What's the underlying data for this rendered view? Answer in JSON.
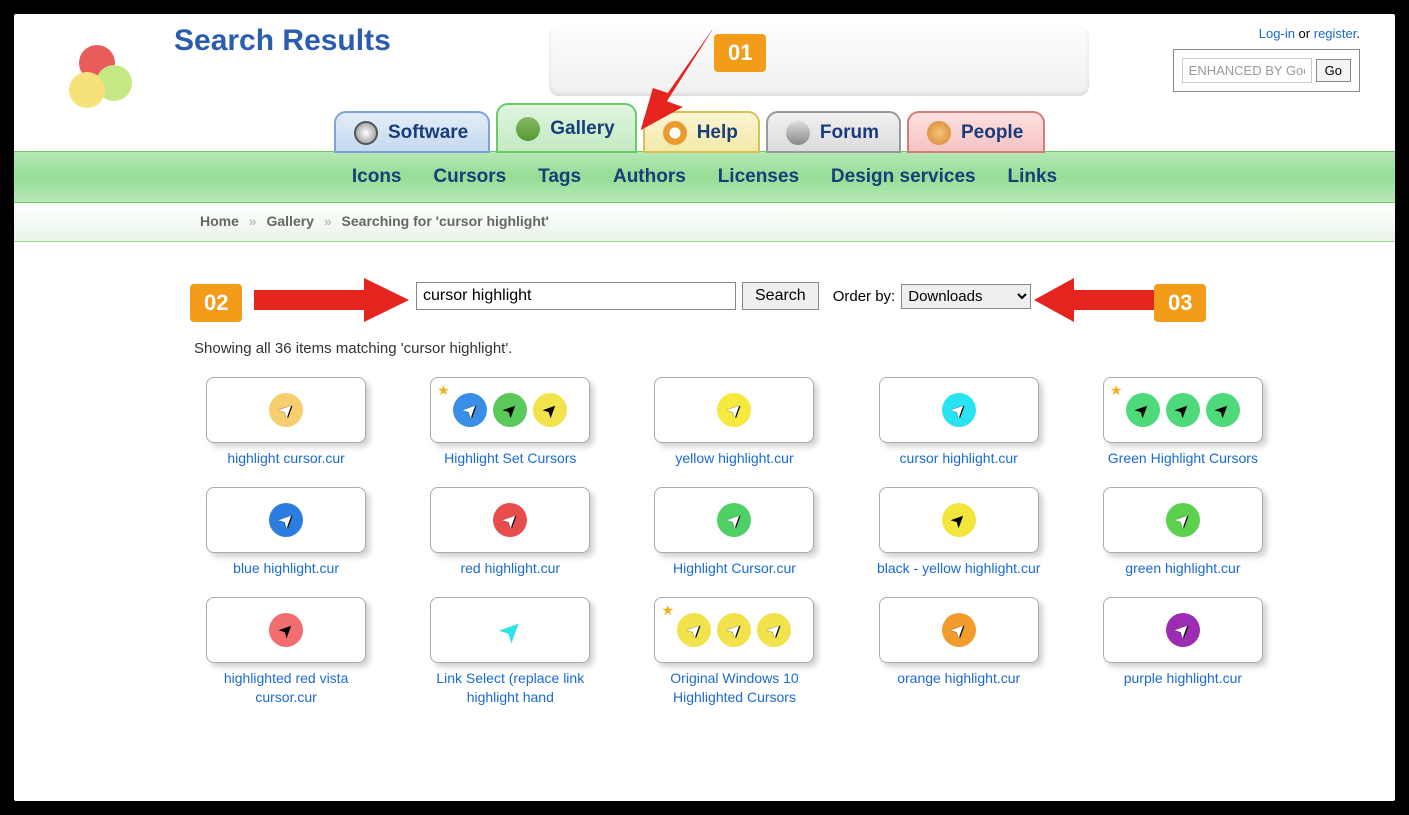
{
  "page_title": "Search Results",
  "top_right": {
    "login": "Log-in",
    "or": " or ",
    "register": "register",
    "dot": ".",
    "google_placeholder": "ENHANCED BY Googl",
    "go": "Go"
  },
  "tabs": {
    "software": "Software",
    "gallery": "Gallery",
    "help": "Help",
    "forum": "Forum",
    "people": "People"
  },
  "subnav": {
    "icons": "Icons",
    "cursors": "Cursors",
    "tags": "Tags",
    "authors": "Authors",
    "licenses": "Licenses",
    "design": "Design services",
    "links": "Links"
  },
  "breadcrumb": {
    "home": "Home",
    "gallery": "Gallery",
    "current": "Searching for 'cursor highlight'"
  },
  "markers": {
    "m1": "01",
    "m2": "02",
    "m3": "03"
  },
  "search": {
    "value": "cursor highlight",
    "button": "Search",
    "orderby_label": "Order by:",
    "orderby_value": "Downloads"
  },
  "results_text": "Showing all 36 items matching 'cursor highlight'.",
  "items": [
    {
      "label": "highlight cursor.cur",
      "star": false,
      "circles": [
        {
          "c": "#f7ce6e",
          "arrow": "white"
        }
      ]
    },
    {
      "label": "Highlight Set Cursors",
      "star": true,
      "circles": [
        {
          "c": "#3a8ee6",
          "arrow": "white"
        },
        {
          "c": "#5ac85a",
          "arrow": "black"
        },
        {
          "c": "#f2e34d",
          "arrow": "black"
        }
      ]
    },
    {
      "label": "yellow highlight.cur",
      "star": false,
      "circles": [
        {
          "c": "#f7e93e",
          "arrow": "white"
        }
      ]
    },
    {
      "label": "cursor highlight.cur",
      "star": false,
      "circles": [
        {
          "c": "#29e3f2",
          "arrow": "white"
        }
      ]
    },
    {
      "label": "Green Highlight Cursors",
      "star": true,
      "circles": [
        {
          "c": "#4ed97a",
          "arrow": "black"
        },
        {
          "c": "#4ed97a",
          "arrow": "black"
        },
        {
          "c": "#4ed97a",
          "arrow": "black"
        }
      ]
    },
    {
      "label": "blue highlight.cur",
      "star": false,
      "circles": [
        {
          "c": "#2d7de0",
          "arrow": "white"
        }
      ]
    },
    {
      "label": "red highlight.cur",
      "star": false,
      "circles": [
        {
          "c": "#e84d4d",
          "arrow": "white"
        }
      ]
    },
    {
      "label": "Highlight Cursor.cur",
      "star": false,
      "circles": [
        {
          "c": "#4dd164",
          "arrow": "white"
        }
      ]
    },
    {
      "label": "black - yellow highlight.cur",
      "star": false,
      "circles": [
        {
          "c": "#f2e63e",
          "arrow": "black"
        }
      ]
    },
    {
      "label": "green highlight.cur",
      "star": false,
      "circles": [
        {
          "c": "#5bd14d",
          "arrow": "white"
        }
      ]
    },
    {
      "label": "highlighted red vista cursor.cur",
      "star": false,
      "circles": [
        {
          "c": "#f26d6d",
          "arrow": "black"
        }
      ]
    },
    {
      "label": "Link Select (replace link highlight hand",
      "star": false,
      "circles": [
        {
          "c": "transparent",
          "arrow": "cyan"
        }
      ]
    },
    {
      "label": "Original Windows 10 Highlighted Cursors",
      "star": true,
      "circles": [
        {
          "c": "#f2e34d",
          "arrow": "white"
        },
        {
          "c": "#f2e34d",
          "arrow": "white"
        },
        {
          "c": "#f2e34d",
          "arrow": "white"
        }
      ]
    },
    {
      "label": "orange highlight.cur",
      "star": false,
      "circles": [
        {
          "c": "#f29c2e",
          "arrow": "white"
        }
      ]
    },
    {
      "label": "purple highlight.cur",
      "star": false,
      "circles": [
        {
          "c": "#9c2db3",
          "arrow": "white"
        }
      ]
    }
  ]
}
